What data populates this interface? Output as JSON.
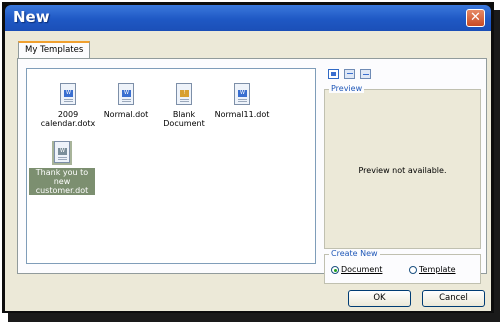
{
  "window": {
    "title": "New",
    "close_glyph": "✕"
  },
  "tab": {
    "label": "My Templates"
  },
  "templates": [
    {
      "line1": "2009",
      "line2": "calendar.dotx"
    },
    {
      "line1": "Normal.dot",
      "line2": ""
    },
    {
      "line1": "Blank",
      "line2": "Document"
    },
    {
      "line1": "Normal11.dot",
      "line2": ""
    },
    {
      "line1": "Thank you to",
      "line2": "new",
      "line3": "customer.dot"
    }
  ],
  "preview": {
    "group_label": "Preview",
    "message": "Preview not available."
  },
  "create_new": {
    "group_label": "Create New",
    "document_label": "Document",
    "template_label": "Template",
    "selected": "document"
  },
  "buttons": {
    "ok": "OK",
    "cancel": "Cancel"
  },
  "icons": {
    "view_large": "large-icons-view-icon",
    "view_list": "list-view-icon",
    "view_details": "details-view-icon"
  }
}
